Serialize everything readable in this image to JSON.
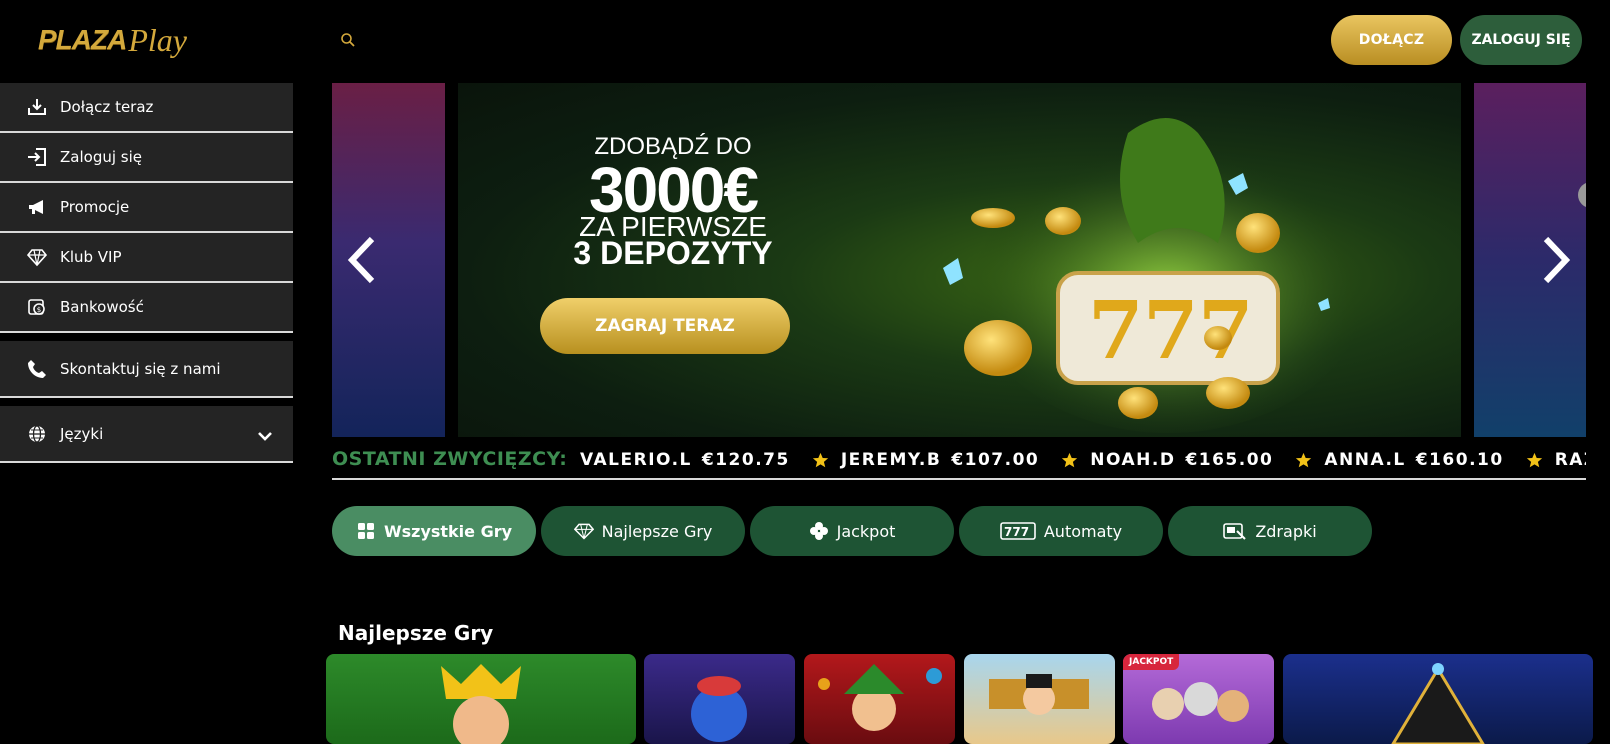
{
  "header": {
    "logo_word1": "PLAZA",
    "logo_word2": "Play",
    "join_label": "DOŁĄCZ",
    "login_label": "ZALOGUJ SIĘ"
  },
  "sidebar": {
    "items": [
      {
        "label": "Dołącz teraz",
        "icon": "download-icon"
      },
      {
        "label": "Zaloguj się",
        "icon": "login-icon"
      },
      {
        "label": "Promocje",
        "icon": "megaphone-icon"
      },
      {
        "label": "Klub VIP",
        "icon": "diamond-icon"
      },
      {
        "label": "Bankowość",
        "icon": "bank-icon"
      },
      {
        "label": "Skontaktuj się z nami",
        "icon": "phone-icon"
      },
      {
        "label": "Języki",
        "icon": "globe-icon"
      }
    ]
  },
  "banner": {
    "line1": "ZDOBĄDŹ DO",
    "line2": "3000€",
    "line3": "ZA PIERWSZE",
    "line4": "3 DEPOZYTY",
    "cta": "ZAGRAJ TERAZ"
  },
  "winners": {
    "label": "OSTATNI ZWYCIĘZCY:",
    "items": [
      {
        "name": "VALERIO.L",
        "amount": "€120.75"
      },
      {
        "name": "JEREMY.B",
        "amount": "€107.00"
      },
      {
        "name": "NOAH.D",
        "amount": "€165.00"
      },
      {
        "name": "ANNA.L",
        "amount": "€160.10"
      },
      {
        "name": "RAZVAN.",
        "amount": ""
      }
    ]
  },
  "tabs": [
    {
      "label": "Wszystkie Gry",
      "icon": "grid-icon",
      "active": true
    },
    {
      "label": "Najlepsze Gry",
      "icon": "diamond-icon",
      "active": false
    },
    {
      "label": "Jackpot",
      "icon": "clover-icon",
      "active": false
    },
    {
      "label": "Automaty",
      "icon": "slot-777-icon",
      "active": false
    },
    {
      "label": "Zdrapki",
      "icon": "scratch-card-icon",
      "active": false
    }
  ],
  "top_games": {
    "title": "Najlepsze Gry",
    "badge": "JACKPOT"
  },
  "colors": {
    "gold": "#d4a93c",
    "green_button": "#2d5e3b",
    "tab_green": "#1e5434",
    "tab_active": "#4a8d63",
    "ticker_green": "#3e8e52"
  }
}
